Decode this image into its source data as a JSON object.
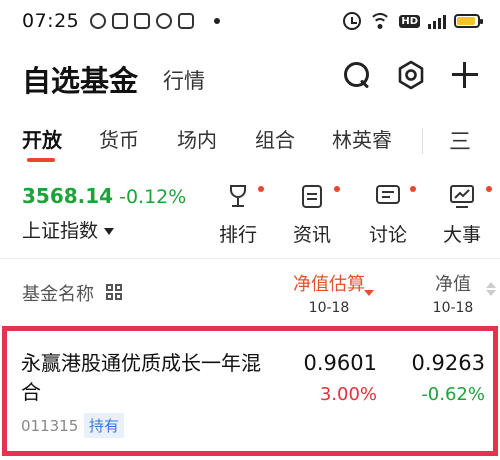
{
  "status_bar": {
    "time": "07:25",
    "hd": "HD",
    "network": "4G",
    "battery_level": 0.9
  },
  "header": {
    "title": "自选基金",
    "secondary_tab": "行情"
  },
  "tabs": [
    {
      "label": "开放"
    },
    {
      "label": "货币"
    },
    {
      "label": "场内"
    },
    {
      "label": "组合"
    },
    {
      "label": "林英睿"
    }
  ],
  "tab_more": "三",
  "index": {
    "value": "3568.14",
    "change": "-0.12%",
    "name": "上证指数",
    "color": "#1ea33b"
  },
  "quick_actions": [
    {
      "label": "排行",
      "icon": "trophy-icon"
    },
    {
      "label": "资讯",
      "icon": "news-icon"
    },
    {
      "label": "讨论",
      "icon": "discuss-icon"
    },
    {
      "label": "大事",
      "icon": "events-icon"
    }
  ],
  "columns": {
    "name": "基金名称",
    "estimate": "净值估算",
    "estimate_date": "10-18",
    "nav": "净值",
    "nav_date": "10-18"
  },
  "fund": {
    "name": "永赢港股通优质成长一年混合",
    "code": "011315",
    "badge": "持有",
    "estimate_value": "0.9601",
    "estimate_change": "3.00%",
    "nav_value": "0.9263",
    "nav_change": "-0.62%"
  },
  "colors": {
    "accent": "#e8472c",
    "up": "#e0323a",
    "down": "#1ea33b",
    "highlight_border": "#e3334e"
  }
}
